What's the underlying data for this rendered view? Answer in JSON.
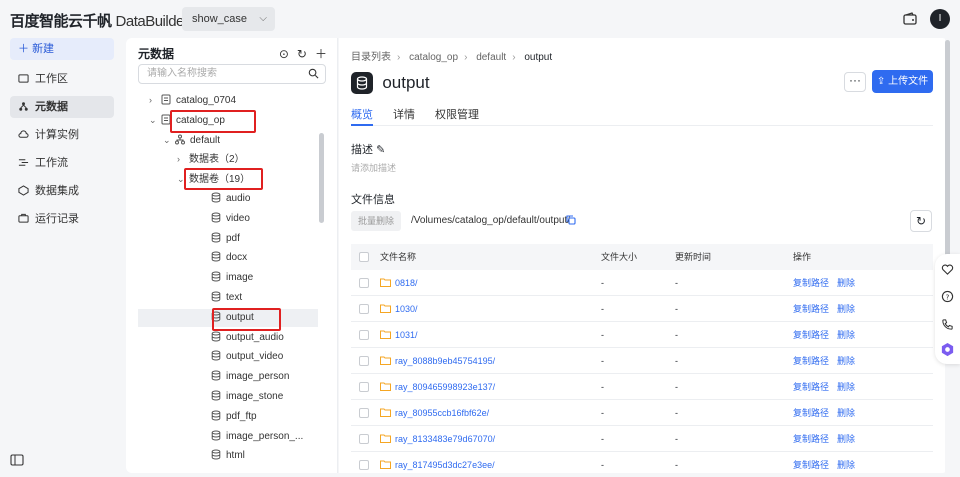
{
  "app": {
    "logo": "百度智能云千帆",
    "product": "DataBuilder",
    "workspace": "show_case",
    "avatar_letter": "I"
  },
  "nav": {
    "new_label": "新建",
    "items": [
      {
        "label": "工作区",
        "icon": "folder-icon"
      },
      {
        "label": "元数据",
        "icon": "metadata-icon",
        "active": true
      },
      {
        "label": "计算实例",
        "icon": "cloud-icon"
      },
      {
        "label": "工作流",
        "icon": "workflow-icon"
      },
      {
        "label": "数据集成",
        "icon": "integration-icon"
      },
      {
        "label": "运行记录",
        "icon": "record-icon"
      }
    ]
  },
  "tree": {
    "title": "元数据",
    "search_placeholder": "请输入名称搜索",
    "rows": [
      {
        "label": "catalog_0704"
      },
      {
        "label": "catalog_op"
      },
      {
        "label": "default"
      },
      {
        "label": "数据表（2）"
      },
      {
        "label": "数据卷（19）"
      },
      {
        "label": "audio"
      },
      {
        "label": "video"
      },
      {
        "label": "pdf"
      },
      {
        "label": "docx"
      },
      {
        "label": "image"
      },
      {
        "label": "text"
      },
      {
        "label": "output"
      },
      {
        "label": "output_audio"
      },
      {
        "label": "output_video"
      },
      {
        "label": "image_person"
      },
      {
        "label": "image_stone"
      },
      {
        "label": "pdf_ftp"
      },
      {
        "label": "image_person_..."
      },
      {
        "label": "html"
      }
    ]
  },
  "main": {
    "breadcrumb": [
      "目录列表",
      "catalog_op",
      "default",
      "output"
    ],
    "title": "output",
    "more_label": "···",
    "upload_label": "上传文件",
    "tabs": [
      "概览",
      "详情",
      "权限管理"
    ],
    "desc_label": "描述",
    "desc_placeholder": "请添加描述",
    "fileinfo_label": "文件信息",
    "batch_delete_label": "批量删除",
    "path": "/Volumes/catalog_op/default/output/",
    "columns": [
      "文件名称",
      "文件大小",
      "更新时间",
      "操作"
    ],
    "copy_path_label": "复制路径",
    "delete_label": "删除",
    "rows": [
      {
        "name": "0818/",
        "size": "-",
        "time": "-"
      },
      {
        "name": "1030/",
        "size": "-",
        "time": "-"
      },
      {
        "name": "1031/",
        "size": "-",
        "time": "-"
      },
      {
        "name": "ray_8088b9eb45754195/",
        "size": "-",
        "time": "-"
      },
      {
        "name": "ray_809465998923e137/",
        "size": "-",
        "time": "-"
      },
      {
        "name": "ray_80955ccb16fbf62e/",
        "size": "-",
        "time": "-"
      },
      {
        "name": "ray_8133483e79d67070/",
        "size": "-",
        "time": "-"
      },
      {
        "name": "ray_817495d3dc27e3ee/",
        "size": "-",
        "time": "-"
      }
    ]
  },
  "colors": {
    "accent": "#2f6bf0",
    "highlight": "#e02020",
    "folder": "#f5a623"
  }
}
